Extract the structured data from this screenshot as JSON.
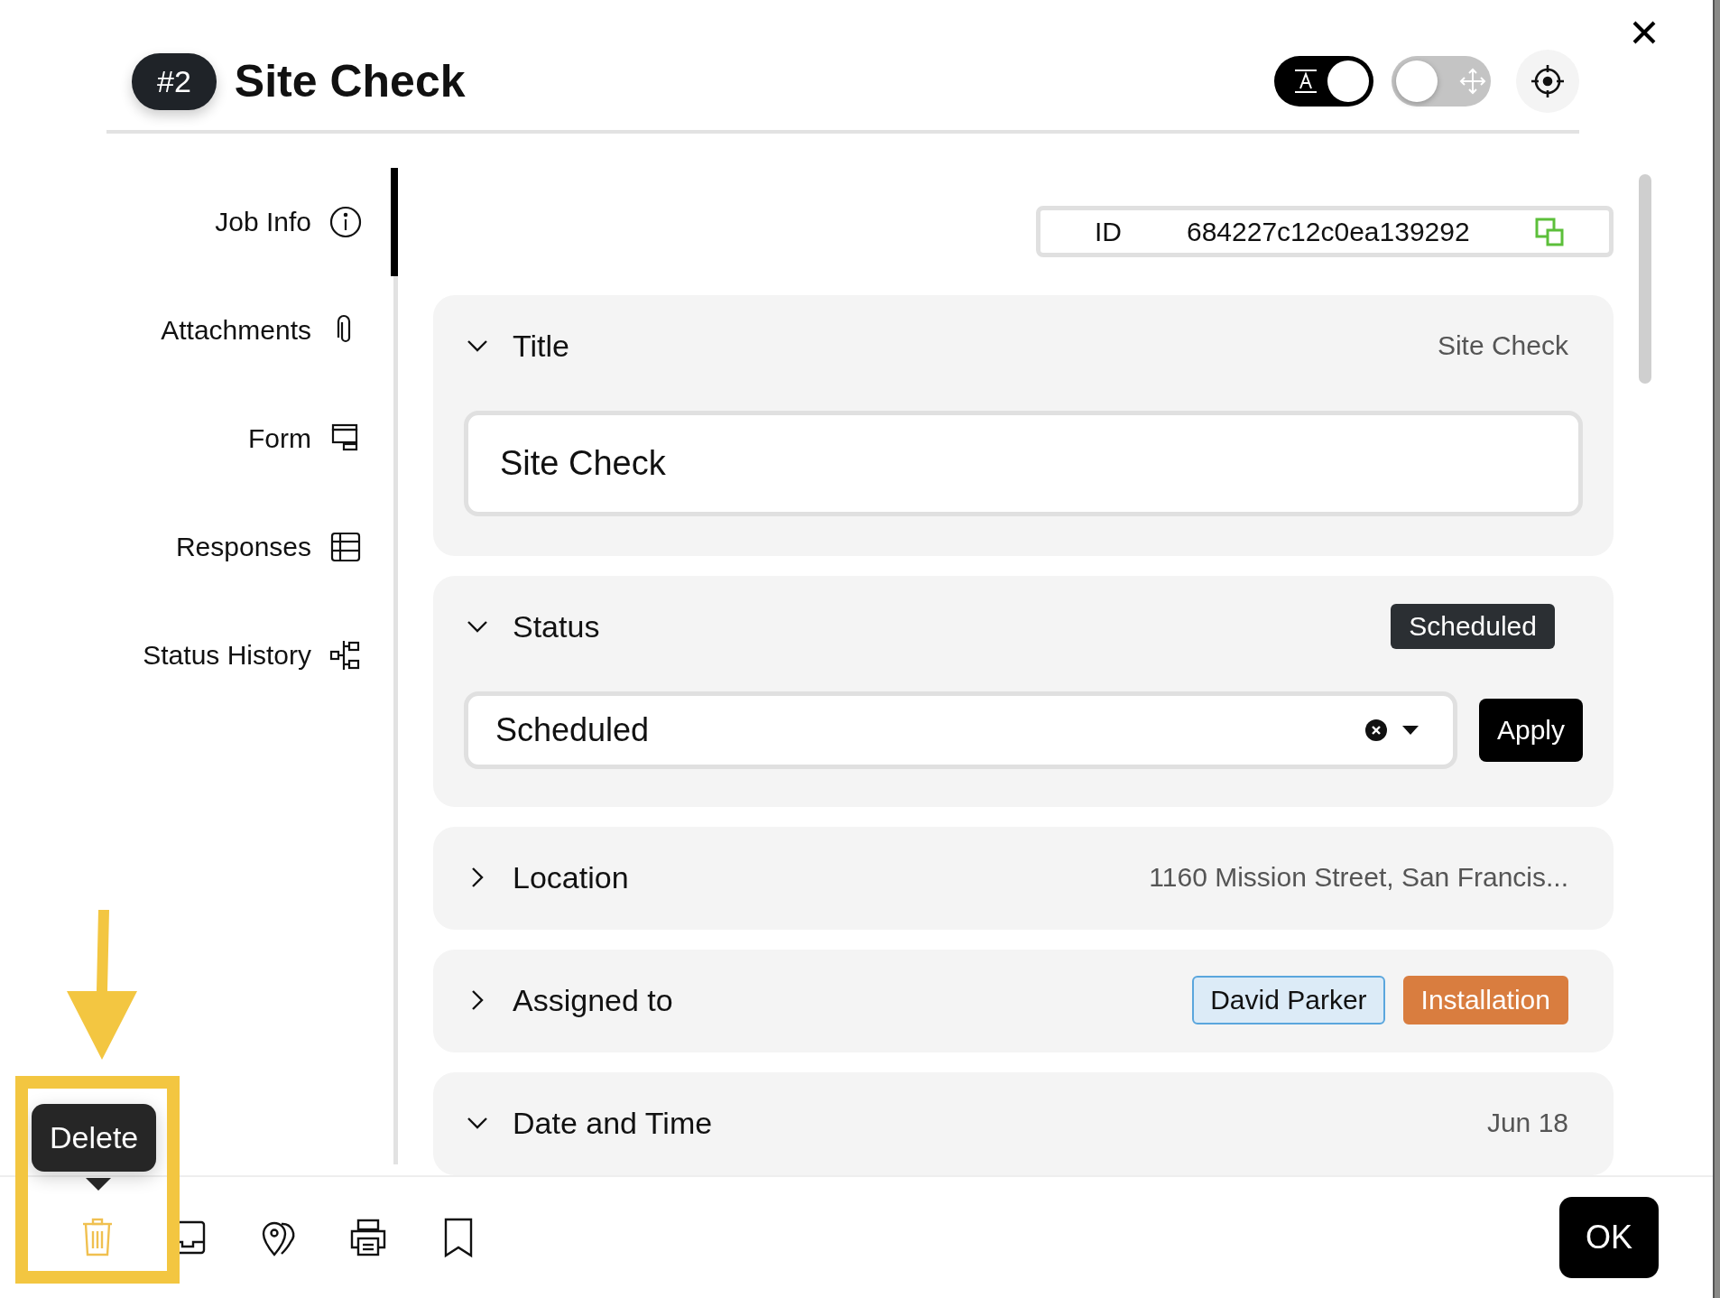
{
  "header": {
    "number": "#2",
    "title": "Site Check",
    "toggles": [
      {
        "kind": "text",
        "on": true
      },
      {
        "kind": "move",
        "on": false
      }
    ]
  },
  "sidebar": {
    "items": [
      {
        "kind": "info",
        "label": "Job Info",
        "selected": true
      },
      {
        "kind": "clip",
        "label": "Attachments",
        "selected": false
      },
      {
        "kind": "form",
        "label": "Form",
        "selected": false
      },
      {
        "kind": "table",
        "label": "Responses",
        "selected": false
      },
      {
        "kind": "history",
        "label": "Status History",
        "selected": false
      }
    ]
  },
  "id_box": {
    "label": "ID",
    "value": "684227c12c0ea139292"
  },
  "sections": [
    {
      "kind": "text_input",
      "title": "Title",
      "expanded": true,
      "summary": "Site Check",
      "value": "Site Check"
    },
    {
      "kind": "select",
      "title": "Status",
      "expanded": true,
      "badge": "Scheduled",
      "value": "Scheduled",
      "button": "Apply"
    },
    {
      "kind": "summary",
      "title": "Location",
      "expanded": false,
      "summary": "1160 Mission Street, San Francis..."
    },
    {
      "kind": "tags",
      "title": "Assigned to",
      "expanded": false,
      "tags": [
        {
          "label": "David Parker",
          "color": "#dcebf7"
        },
        {
          "label": "Installation",
          "color": "#d97d3f"
        }
      ]
    },
    {
      "kind": "summary",
      "title": "Date and Time",
      "expanded": true,
      "summary": "Jun 18"
    }
  ],
  "footer": {
    "tools": [
      {
        "kind": "trash",
        "highlighted": true,
        "tooltip": "Delete"
      },
      {
        "kind": "inbox",
        "highlighted": false
      },
      {
        "kind": "pins",
        "highlighted": false
      },
      {
        "kind": "printer",
        "highlighted": false
      },
      {
        "kind": "bookmark",
        "highlighted": false
      }
    ],
    "ok": "OK"
  }
}
